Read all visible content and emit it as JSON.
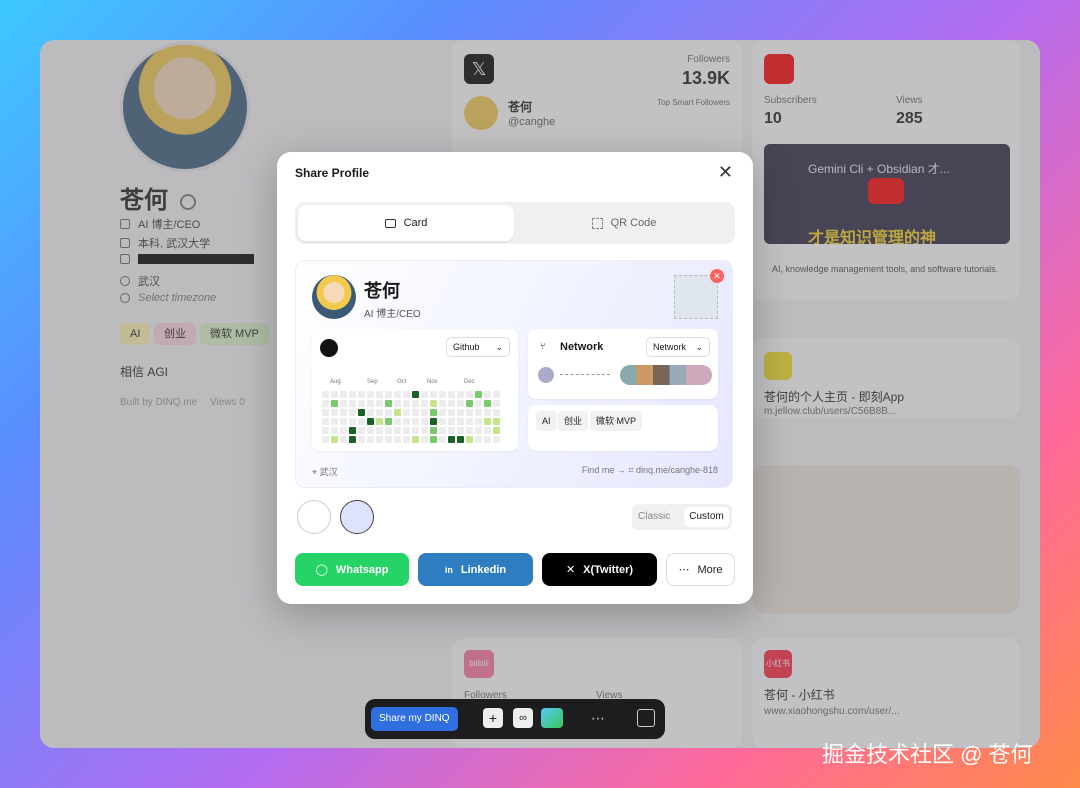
{
  "profile": {
    "name": "苍何",
    "title": "AI 博主/CEO",
    "education": "本科, 武汉大学",
    "location": "武汉",
    "timezone_placeholder": "Select timezone",
    "tags": [
      "AI",
      "创业",
      "微软 MVP"
    ],
    "bio": "相信 AGI",
    "built_by": "Built by DINQ.me",
    "views": "Views 0"
  },
  "twitter_card": {
    "followers_label": "Followers",
    "followers": "13.9K",
    "name": "苍何",
    "handle": "@canghe",
    "top_smart_followers": "Top Smart Followers"
  },
  "youtube_card": {
    "subscribers_label": "Subscribers",
    "subscribers": "10",
    "views_label": "Views",
    "views": "285",
    "video_title": "Gemini Cli + Obsidian 才...",
    "video_caption": "才是知识管理的神",
    "description": "AI, knowledge management tools, and software tutorials."
  },
  "jellow_card": {
    "title": "苍何的个人主页 - 即刻App",
    "url": "m.jellow.club/users/C56B8B..."
  },
  "xhs_card": {
    "logo": "小红书",
    "title": "苍何 - 小红书",
    "url": "www.xiaohongshu.com/user/..."
  },
  "bilibili_card": {
    "logo": "bilibili",
    "followers_label": "Followers",
    "views_label": "Views"
  },
  "modal": {
    "title": "Share Profile",
    "tabs": [
      "Card",
      "QR Code"
    ],
    "card": {
      "name": "苍何",
      "title": "AI 博主/CEO",
      "github_select": "Github",
      "months": [
        "Aug",
        "Sep",
        "Oct",
        "Nov",
        "Dec"
      ],
      "network_label": "Network",
      "network_select": "Network",
      "tags": [
        "AI",
        "创业",
        "微软 MVP"
      ],
      "location": "武汉",
      "find_me": "Find me →",
      "link": "dinq.me/canghe-818"
    },
    "style_options": [
      "Classic",
      "Custom"
    ],
    "share_buttons": [
      "Whatsapp",
      "Linkedin",
      "X(Twitter)",
      "More"
    ],
    "colors": {
      "whatsapp": "#25d366",
      "linkedin": "#2d7dc0",
      "x": "#000000"
    }
  },
  "dock": {
    "share_label": "Share my DINQ"
  },
  "watermark": "掘金技术社区 @ 苍何"
}
